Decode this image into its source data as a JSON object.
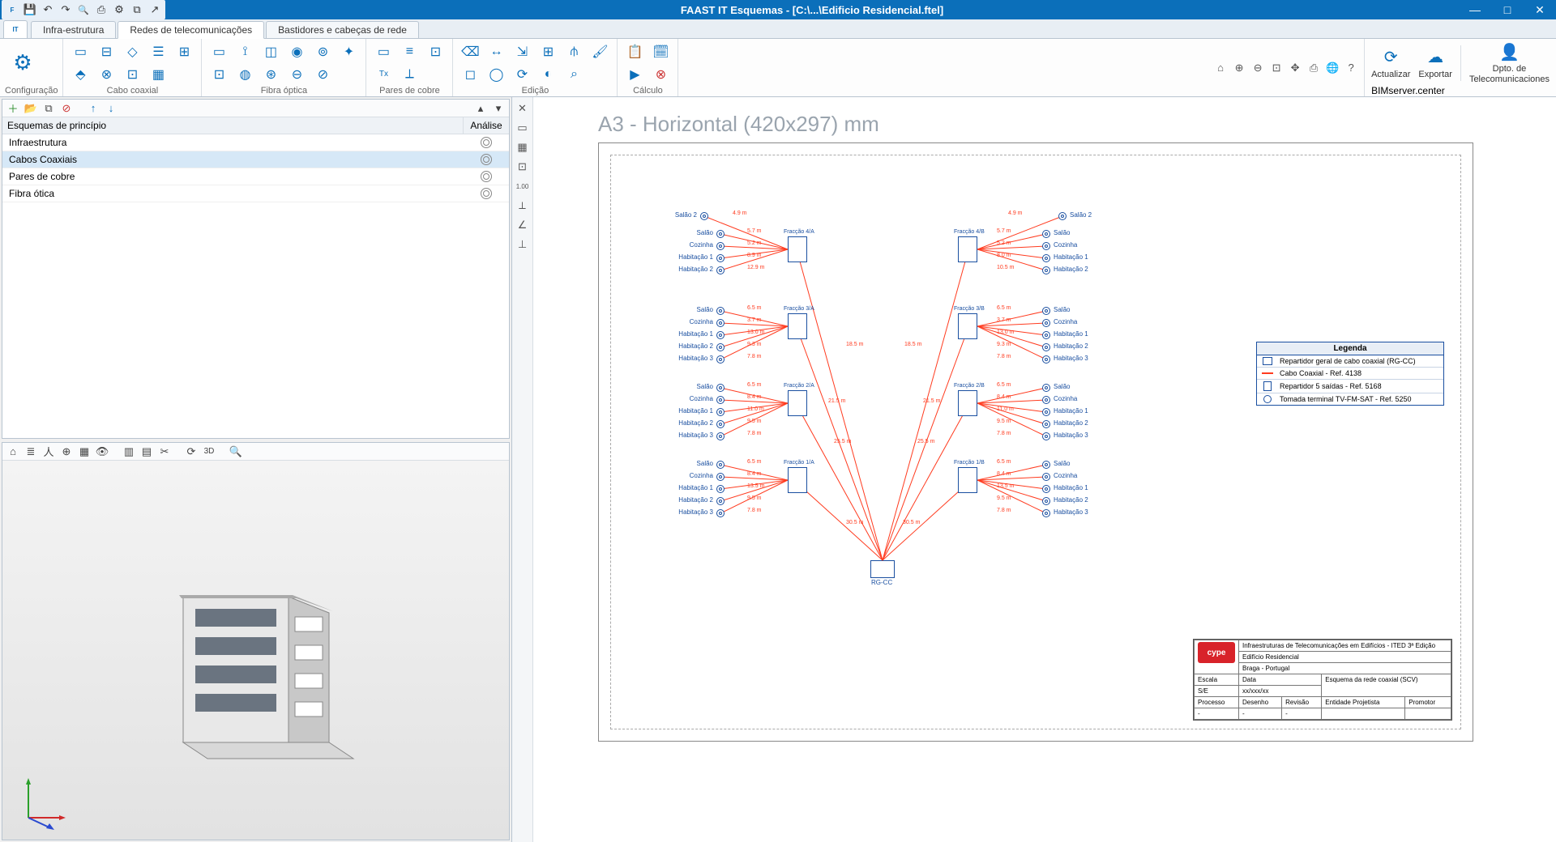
{
  "app": {
    "title": "FAAST IT Esquemas - [C:\\...\\Edificio Residencial.ftel]"
  },
  "tabs": {
    "t1": "Infra-estrutura",
    "t2": "Redes de telecomunicações",
    "t3": "Bastidores e cabeças de rede"
  },
  "ribbon": {
    "config": "Configuração",
    "coax": "Cabo coaxial",
    "fibra": "Fibra óptica",
    "pares": "Pares de cobre",
    "edicao": "Edição",
    "calculo": "Cálculo",
    "bimserver": "BIMserver.center",
    "actualizar": "Actualizar",
    "exportar": "Exportar",
    "dpto": "Dpto. de",
    "dpto2": "Telecomunicaciones"
  },
  "treepanel": {
    "header": "Esquemas de princípio",
    "analise": "Análise",
    "rows": {
      "r0": "Infraestrutura",
      "r1": "Cabos Coaxiais",
      "r2": "Pares de cobre",
      "r3": "Fibra ótica"
    }
  },
  "sheet": {
    "title": "A3 - Horizontal (420x297) mm"
  },
  "legend": {
    "title": "Legenda",
    "l1": "Repartidor geral de cabo coaxial (RG-CC)",
    "l2": "Cabo Coaxial - Ref. 4138",
    "l3": "Repartidor 5 saídas - Ref. 5168",
    "l4": "Tomada terminal TV-FM-SAT - Ref. 5250"
  },
  "titleblock": {
    "head": "Infraestruturas de Telecomunicações em Edifícios - ITED 3ª Edição",
    "proj": "Edifício Residencial",
    "loc": "Braga - Portugal",
    "escala_h": "Escala",
    "escala": "S/E",
    "data_h": "Data",
    "data": "xx/xxx/xx",
    "esq": "Esquema da rede coaxial (SCV)",
    "processo": "Processo",
    "desenho": "Desenho",
    "revisao": "Revisão",
    "ent": "Entidade Projetista",
    "prom": "Promotor",
    "dash": "-"
  },
  "schematic": {
    "rgcc": "RG-CC",
    "fracao_4a": "Fracção 4/A",
    "fracao_4b": "Fracção 4/B",
    "fracao_3a": "Fracção 3/A",
    "fracao_3b": "Fracção 3/B",
    "fracao_2a": "Fracção 2/A",
    "fracao_2b": "Fracção 2/B",
    "fracao_1a": "Fracção 1/A",
    "fracao_1b": "Fracção 1/B",
    "salao": "Salão",
    "salao2": "Salão 2",
    "cozinha": "Cozinha",
    "hab1": "Habitação 1",
    "hab2": "Habitação 2",
    "hab3": "Habitação 3",
    "d_4_9": "4.9 m",
    "d_5_7": "5.7 m",
    "d_5_2": "5.2 m",
    "d_8_9": "8.9 m",
    "d_8_0": "8.0 m",
    "d_12_9": "12.9 m",
    "d_10_5": "10.5 m",
    "d_6_5": "6.5 m",
    "d_3_7": "3.7 m",
    "d_13_0": "13.0 m",
    "d_9_3": "9.3 m",
    "d_7_8": "7.8 m",
    "d_8_4": "8.4 m",
    "d_11_0": "11.0 m",
    "d_9_5": "9.5 m",
    "d_13_5": "13.5 m",
    "d_18_5": "18.5 m",
    "d_21_5": "21.5 m",
    "d_25_5": "25.5 m",
    "d_30_5": "30.5 m"
  }
}
